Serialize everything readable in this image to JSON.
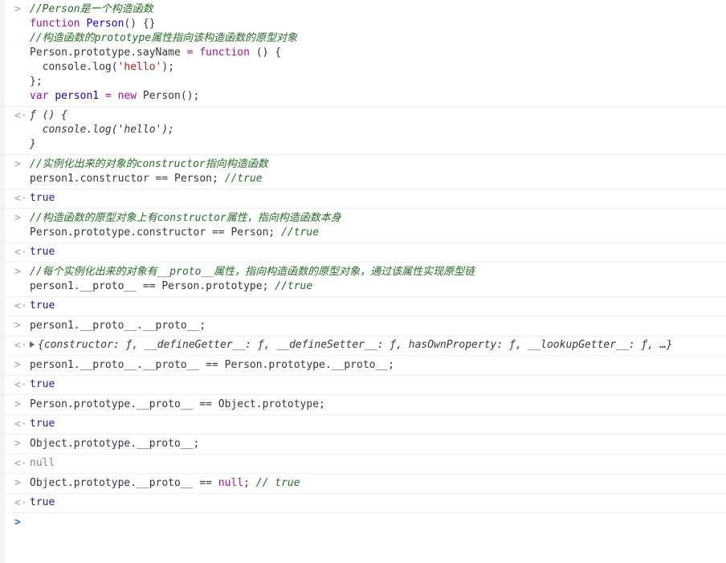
{
  "prompt_glyph": ">",
  "return_glyph": "<·",
  "entries": [
    {
      "type": "input",
      "lines": [
        "//Person是一个构造函数",
        "function Person() {}",
        "//构造函数的prototype属性指向该构造函数的原型对象",
        "Person.prototype.sayName = function () {",
        "  console.log('hello');",
        "};",
        "var person1 = new Person();"
      ]
    },
    {
      "type": "output",
      "lines": [
        "ƒ () {",
        "  console.log('hello');",
        "}"
      ]
    },
    {
      "type": "input",
      "lines": [
        "//实例化出来的对象的constructor指向构造函数",
        "person1.constructor == Person; //true"
      ]
    },
    {
      "type": "output",
      "value": "true"
    },
    {
      "type": "input",
      "lines": [
        "//构造函数的原型对象上有constructor属性，指向构造函数本身",
        "Person.prototype.constructor == Person; //true"
      ]
    },
    {
      "type": "output",
      "value": "true"
    },
    {
      "type": "input",
      "lines": [
        "//每个实例化出来的对象有__proto__属性，指向构造函数的原型对象，通过该属性实现原型链",
        "person1.__proto__ == Person.prototype; //true"
      ]
    },
    {
      "type": "output",
      "value": "true"
    },
    {
      "type": "input",
      "lines": [
        "person1.__proto__.__proto__;"
      ]
    },
    {
      "type": "output",
      "value": "{constructor: ƒ, __defineGetter__: ƒ, __defineSetter__: ƒ, hasOwnProperty: ƒ, __lookupGetter__: ƒ, …}"
    },
    {
      "type": "input",
      "lines": [
        "person1.__proto__.__proto__ == Person.prototype.__proto__;"
      ]
    },
    {
      "type": "output",
      "value": "true"
    },
    {
      "type": "input",
      "lines": [
        "Person.prototype.__proto__ == Object.prototype;"
      ]
    },
    {
      "type": "output",
      "value": "true"
    },
    {
      "type": "input",
      "lines": [
        "Object.prototype.__proto__;"
      ]
    },
    {
      "type": "output",
      "value": "null"
    },
    {
      "type": "input",
      "lines": [
        "Object.prototype.__proto__ == null; // true"
      ]
    },
    {
      "type": "output",
      "value": "true"
    }
  ],
  "icons": {
    "input_prompt": "chevron-right-icon",
    "output_return": "return-arrow-icon",
    "expand": "triangle-right-icon",
    "active_prompt": "chevron-right-icon"
  },
  "colors": {
    "comment": "#236e25",
    "keyword": "#aa0d91",
    "string": "#c41a16",
    "return_value": "#1a1aa6",
    "active_prompt": "#1a73e8"
  }
}
